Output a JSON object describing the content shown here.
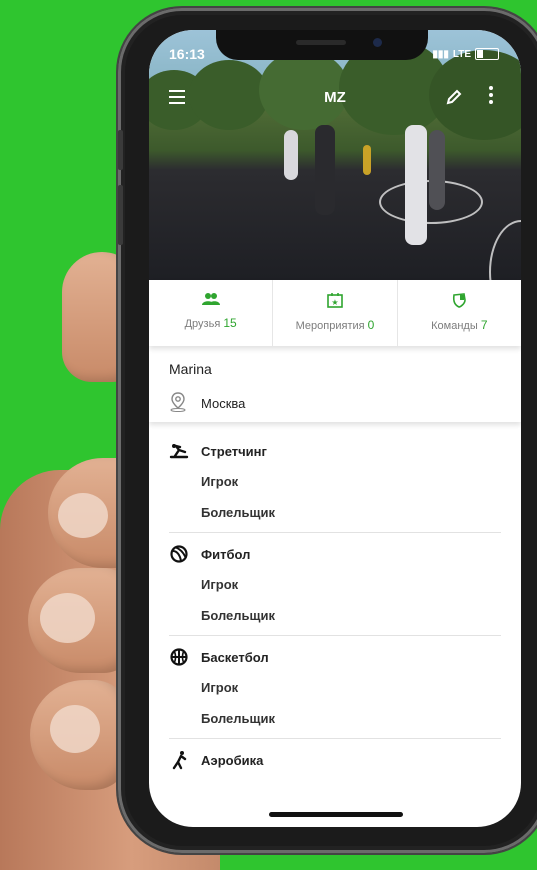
{
  "status_bar": {
    "time": "16:13",
    "network": "LTE"
  },
  "header": {
    "title": "MZ"
  },
  "stats": [
    {
      "label": "Друзья",
      "count": "15",
      "icon": "friends-icon"
    },
    {
      "label": "Мероприятия",
      "count": "0",
      "icon": "events-calendar-icon"
    },
    {
      "label": "Команды",
      "count": "7",
      "icon": "teams-shield-icon"
    }
  ],
  "profile": {
    "name": "Marina",
    "city": "Москва"
  },
  "sports": [
    {
      "name": "Стретчинг",
      "icon": "stretching-icon",
      "roles": [
        "Игрок",
        "Болельщик"
      ]
    },
    {
      "name": "Фитбол",
      "icon": "fitball-icon",
      "roles": [
        "Игрок",
        "Болельщик"
      ]
    },
    {
      "name": "Баскетбол",
      "icon": "basketball-icon",
      "roles": [
        "Игрок",
        "Болельщик"
      ]
    },
    {
      "name": "Аэробика",
      "icon": "aerobics-icon",
      "roles": []
    }
  ],
  "colors": {
    "background": "#2fc52f",
    "accent": "#2fa52f"
  }
}
